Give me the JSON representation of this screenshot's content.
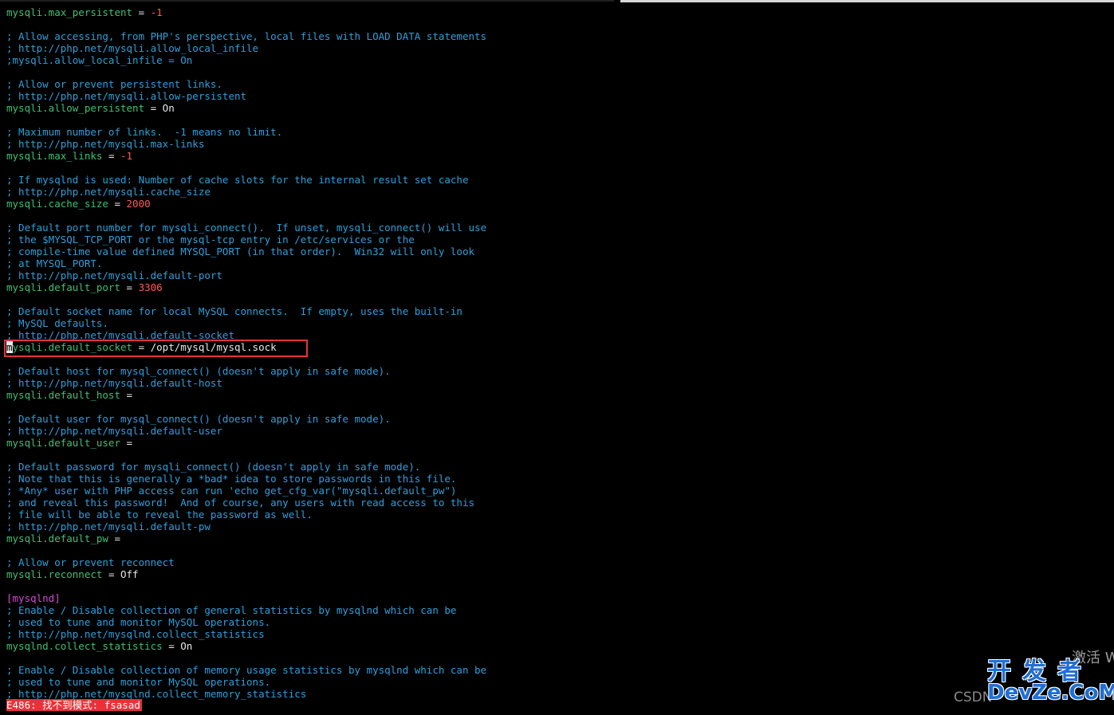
{
  "app": {
    "type": "terminal-vim"
  },
  "editor": {
    "lines": [
      [
        {
          "t": "mysqli.max_persistent",
          "c": "key"
        },
        {
          "t": " = ",
          "c": "eq"
        },
        {
          "t": "-1",
          "c": "num"
        }
      ],
      [],
      [
        {
          "t": "; Allow accessing, from PHP's perspective, local files with LOAD DATA statements",
          "c": "comment"
        }
      ],
      [
        {
          "t": "; http://php.net/mysqli.allow_local_infile",
          "c": "comment"
        }
      ],
      [
        {
          "t": ";mysqli.allow_local_infile = On",
          "c": "comment"
        }
      ],
      [],
      [
        {
          "t": "; Allow or prevent persistent links.",
          "c": "comment"
        }
      ],
      [
        {
          "t": "; http://php.net/mysqli.allow-persistent",
          "c": "comment"
        }
      ],
      [
        {
          "t": "mysqli.allow_persistent",
          "c": "key"
        },
        {
          "t": " = ",
          "c": "eq"
        },
        {
          "t": "On",
          "c": "val"
        }
      ],
      [],
      [
        {
          "t": "; Maximum number of links.  -1 means no limit.",
          "c": "comment"
        }
      ],
      [
        {
          "t": "; http://php.net/mysqli.max-links",
          "c": "comment"
        }
      ],
      [
        {
          "t": "mysqli.max_links",
          "c": "key"
        },
        {
          "t": " = ",
          "c": "eq"
        },
        {
          "t": "-1",
          "c": "num"
        }
      ],
      [],
      [
        {
          "t": "; If mysqlnd is used: Number of cache slots for the internal result set cache",
          "c": "comment"
        }
      ],
      [
        {
          "t": "; http://php.net/mysqli.cache_size",
          "c": "comment"
        }
      ],
      [
        {
          "t": "mysqli.cache_size",
          "c": "key"
        },
        {
          "t": " = ",
          "c": "eq"
        },
        {
          "t": "2000",
          "c": "num"
        }
      ],
      [],
      [
        {
          "t": "; Default port number for mysqli_connect().  If unset, mysqli_connect() will use",
          "c": "comment"
        }
      ],
      [
        {
          "t": "; the $MYSQL_TCP_PORT or the mysql-tcp entry in /etc/services or the",
          "c": "comment"
        }
      ],
      [
        {
          "t": "; compile-time value defined MYSQL_PORT (in that order).  Win32 will only look",
          "c": "comment"
        }
      ],
      [
        {
          "t": "; at MYSQL_PORT.",
          "c": "comment"
        }
      ],
      [
        {
          "t": "; http://php.net/mysqli.default-port",
          "c": "comment"
        }
      ],
      [
        {
          "t": "mysqli.default_port",
          "c": "key"
        },
        {
          "t": " = ",
          "c": "eq"
        },
        {
          "t": "3306",
          "c": "num"
        }
      ],
      [],
      [
        {
          "t": "; Default socket name for local MySQL connects.  If empty, uses the built-in",
          "c": "comment"
        }
      ],
      [
        {
          "t": "; MySQL defaults.",
          "c": "comment"
        }
      ],
      [
        {
          "t": "; http://php.net/mysqli.default-socket",
          "c": "comment"
        }
      ],
      [
        {
          "t": "m",
          "c": "cursor"
        },
        {
          "t": "ysqli.default_socket",
          "c": "key"
        },
        {
          "t": " = ",
          "c": "eq"
        },
        {
          "t": "/opt/mysql/mysql.sock",
          "c": "val"
        }
      ],
      [],
      [
        {
          "t": "; Default host for mysql_connect() (doesn't apply in safe mode).",
          "c": "comment"
        }
      ],
      [
        {
          "t": "; http://php.net/mysqli.default-host",
          "c": "comment"
        }
      ],
      [
        {
          "t": "mysqli.default_host",
          "c": "key"
        },
        {
          "t": " =",
          "c": "eq"
        }
      ],
      [],
      [
        {
          "t": "; Default user for mysql_connect() (doesn't apply in safe mode).",
          "c": "comment"
        }
      ],
      [
        {
          "t": "; http://php.net/mysqli.default-user",
          "c": "comment"
        }
      ],
      [
        {
          "t": "mysqli.default_user",
          "c": "key"
        },
        {
          "t": " =",
          "c": "eq"
        }
      ],
      [],
      [
        {
          "t": "; Default password for mysqli_connect() (doesn't apply in safe mode).",
          "c": "comment"
        }
      ],
      [
        {
          "t": "; Note that this is generally a *bad* idea to store passwords in this file.",
          "c": "comment"
        }
      ],
      [
        {
          "t": "; *Any* user with PHP access can run 'echo get_cfg_var(\"mysqli.default_pw\")",
          "c": "comment"
        }
      ],
      [
        {
          "t": "; and reveal this password!  And of course, any users with read access to this",
          "c": "comment"
        }
      ],
      [
        {
          "t": "; file will be able to reveal the password as well.",
          "c": "comment"
        }
      ],
      [
        {
          "t": "; http://php.net/mysqli.default-pw",
          "c": "comment"
        }
      ],
      [
        {
          "t": "mysqli.default_pw",
          "c": "key"
        },
        {
          "t": " =",
          "c": "eq"
        }
      ],
      [],
      [
        {
          "t": "; Allow or prevent reconnect",
          "c": "comment"
        }
      ],
      [
        {
          "t": "mysqli.reconnect",
          "c": "key"
        },
        {
          "t": " = ",
          "c": "eq"
        },
        {
          "t": "Off",
          "c": "val"
        }
      ],
      [],
      [
        {
          "t": "[mysqlnd]",
          "c": "section"
        }
      ],
      [
        {
          "t": "; Enable / Disable collection of general statistics by mysqlnd which can be",
          "c": "comment"
        }
      ],
      [
        {
          "t": "; used to tune and monitor MySQL operations.",
          "c": "comment"
        }
      ],
      [
        {
          "t": "; http://php.net/mysqlnd.collect_statistics",
          "c": "comment"
        }
      ],
      [
        {
          "t": "mysqlnd.collect_statistics",
          "c": "key"
        },
        {
          "t": " = ",
          "c": "eq"
        },
        {
          "t": "On",
          "c": "val"
        }
      ],
      [],
      [
        {
          "t": "; Enable / Disable collection of memory usage statistics by mysqlnd which can be",
          "c": "comment"
        }
      ],
      [
        {
          "t": "; used to tune and monitor MySQL operations.",
          "c": "comment"
        }
      ],
      [
        {
          "t": "; http://php.net/mysqlnd.collect_memory_statistics",
          "c": "comment"
        }
      ]
    ]
  },
  "status": {
    "error_message": "E486: 找不到模式: fsasad"
  },
  "watermarks": {
    "activate": "激活 W",
    "csdn": "CSDN",
    "devze_cn": "开发者",
    "devze_en": "DevZe.CoM"
  },
  "colors": {
    "background": "#000000",
    "comment": "#2f9fdb",
    "key": "#3fbf74",
    "number": "#ff5b5b",
    "value": "#e9e9e9",
    "section": "#d848d8",
    "highlight_border": "#e8323a",
    "error_background": "#e8323a"
  }
}
